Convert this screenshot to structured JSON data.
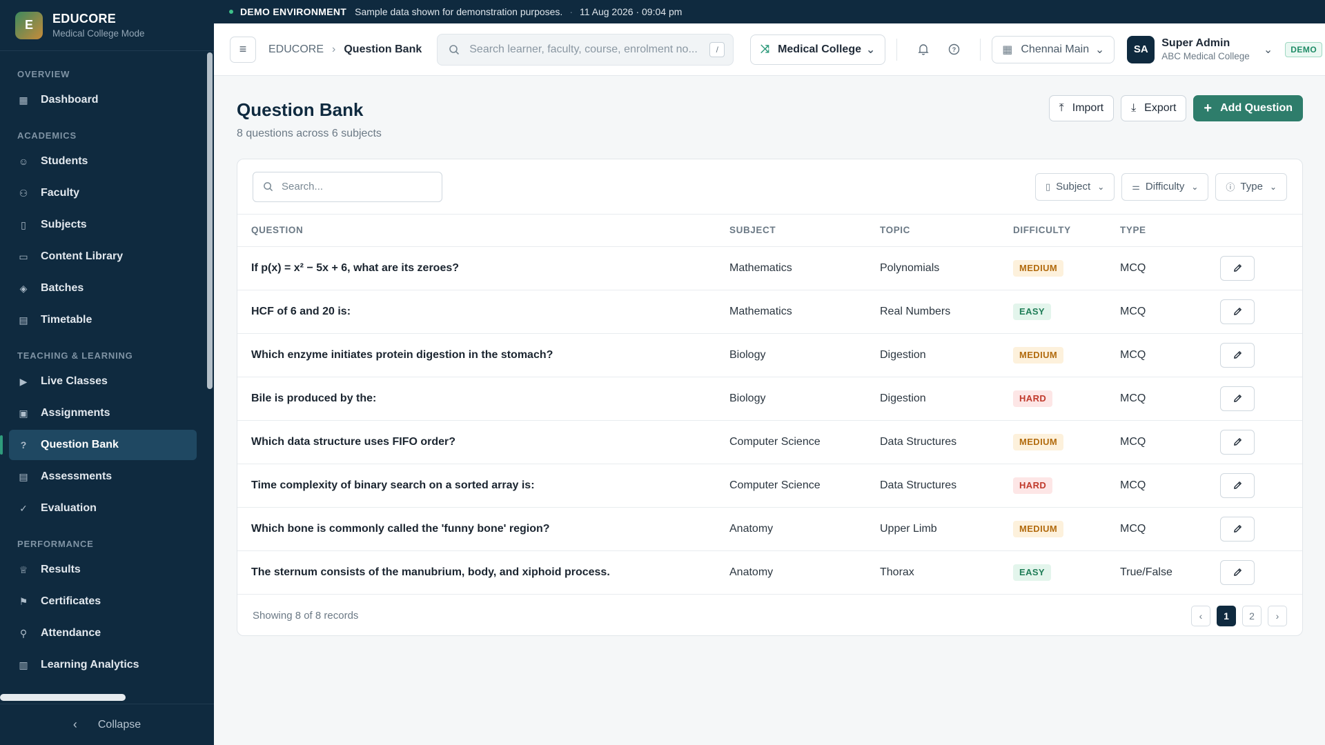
{
  "brand": {
    "logo_letter": "E",
    "title": "EDUCORE",
    "subtitle": "Medical College Mode"
  },
  "sidebar": {
    "sections": [
      {
        "title": "OVERVIEW",
        "items": [
          {
            "label": "Dashboard",
            "icon": "grid-icon"
          }
        ]
      },
      {
        "title": "ACADEMICS",
        "items": [
          {
            "label": "Students",
            "icon": "users-icon"
          },
          {
            "label": "Faculty",
            "icon": "user-group-icon"
          },
          {
            "label": "Subjects",
            "icon": "book-icon"
          },
          {
            "label": "Content Library",
            "icon": "folder-icon"
          },
          {
            "label": "Batches",
            "icon": "layers-icon"
          },
          {
            "label": "Timetable",
            "icon": "calendar-icon"
          }
        ]
      },
      {
        "title": "TEACHING & LEARNING",
        "items": [
          {
            "label": "Live Classes",
            "icon": "video-icon"
          },
          {
            "label": "Assignments",
            "icon": "clipboard-icon"
          },
          {
            "label": "Question Bank",
            "icon": "help-circle-icon",
            "active": true
          },
          {
            "label": "Assessments",
            "icon": "calendar-check-icon"
          },
          {
            "label": "Evaluation",
            "icon": "check-circle-icon"
          }
        ]
      },
      {
        "title": "PERFORMANCE",
        "items": [
          {
            "label": "Results",
            "icon": "award-icon"
          },
          {
            "label": "Certificates",
            "icon": "bookmark-icon"
          },
          {
            "label": "Attendance",
            "icon": "user-check-icon"
          },
          {
            "label": "Learning Analytics",
            "icon": "bar-chart-icon"
          }
        ]
      }
    ],
    "collapse_label": "Collapse"
  },
  "banner": {
    "title": "DEMO ENVIRONMENT",
    "message": "Sample data shown for demonstration purposes.",
    "datetime": "11 Aug 2026 · 09:04 pm"
  },
  "header": {
    "breadcrumb_root": "EDUCORE",
    "breadcrumb_current": "Question Bank",
    "search_placeholder": "Search learner, faculty, course, enrolment no...",
    "search_shortcut": "/",
    "mode_label": "Medical College",
    "campus_label": "Chennai Main",
    "user_initials": "SA",
    "user_name": "Super Admin",
    "user_org": "ABC Medical College",
    "demo_badge": "DEMO"
  },
  "page": {
    "title": "Question Bank",
    "subtitle": "8 questions across 6 subjects",
    "import_label": "Import",
    "export_label": "Export",
    "add_label": "Add Question"
  },
  "table": {
    "search_placeholder": "Search...",
    "filters": [
      "Subject",
      "Difficulty",
      "Type"
    ],
    "columns": [
      "QUESTION",
      "SUBJECT",
      "TOPIC",
      "DIFFICULTY",
      "TYPE"
    ],
    "rows": [
      {
        "question": "If p(x) = x² − 5x + 6, what are its zeroes?",
        "subject": "Mathematics",
        "topic": "Polynomials",
        "difficulty": "MEDIUM",
        "type": "MCQ"
      },
      {
        "question": "HCF of 6 and 20 is:",
        "subject": "Mathematics",
        "topic": "Real Numbers",
        "difficulty": "EASY",
        "type": "MCQ"
      },
      {
        "question": "Which enzyme initiates protein digestion in the stomach?",
        "subject": "Biology",
        "topic": "Digestion",
        "difficulty": "MEDIUM",
        "type": "MCQ"
      },
      {
        "question": "Bile is produced by the:",
        "subject": "Biology",
        "topic": "Digestion",
        "difficulty": "HARD",
        "type": "MCQ"
      },
      {
        "question": "Which data structure uses FIFO order?",
        "subject": "Computer Science",
        "topic": "Data Structures",
        "difficulty": "MEDIUM",
        "type": "MCQ"
      },
      {
        "question": "Time complexity of binary search on a sorted array is:",
        "subject": "Computer Science",
        "topic": "Data Structures",
        "difficulty": "HARD",
        "type": "MCQ"
      },
      {
        "question": "Which bone is commonly called the 'funny bone' region?",
        "subject": "Anatomy",
        "topic": "Upper Limb",
        "difficulty": "MEDIUM",
        "type": "MCQ"
      },
      {
        "question": "The sternum consists of the manubrium, body, and xiphoid process.",
        "subject": "Anatomy",
        "topic": "Thorax",
        "difficulty": "EASY",
        "type": "True/False"
      }
    ],
    "showing": "Showing 8 of 8 records",
    "pages": [
      "1",
      "2"
    ],
    "current_page": "1"
  },
  "colors": {
    "sidebar_bg": "#0f2a3f",
    "accent": "#2e7d6b",
    "medium": "#b26b0e",
    "easy": "#1f7d57",
    "hard": "#c0392b"
  }
}
